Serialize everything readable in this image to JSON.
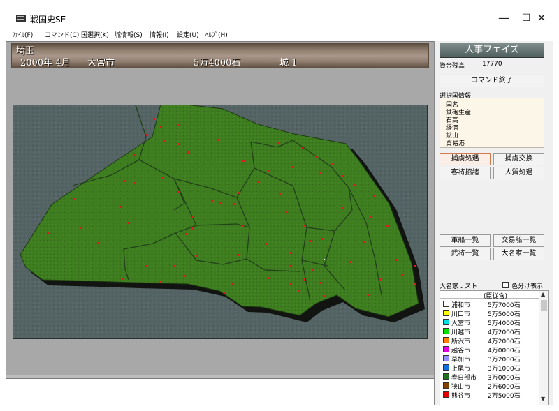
{
  "window": {
    "title": "戦国史SE",
    "minimize": "—",
    "maximize": "☐",
    "close": "✕"
  },
  "menu": [
    "ﾌｧｲﾙ(F)",
    "コマンド(C)",
    "国選択(K)",
    "城情報(S)",
    "情報(I)",
    "設定(U)",
    "ﾍﾙﾌﾟ(H)"
  ],
  "info": {
    "province": "埼玉",
    "date": "2000年 4月",
    "city": "大宮市",
    "yield": "5万4000石",
    "castles": "城 1"
  },
  "panel": {
    "phase": "人事フェイズ",
    "funds_label": "資金残高",
    "funds_value": "17770",
    "command_end": "コマンド終了",
    "selected_label": "選択国情報",
    "selected_lines": [
      "国名",
      "鉄砲生産",
      "石高",
      "経済",
      "鉱山",
      "貿易港"
    ],
    "buttons": {
      "capture_handle": "捕虜処遇",
      "capture_swap": "捕虜交換",
      "guest_recruit": "客将招諸",
      "hostage": "人質処遇",
      "warships": "軍船一覧",
      "tradeships": "交易船一覧",
      "generals": "武将一覧",
      "daimyos": "大名家一覧"
    },
    "daimyo_list_label": "大名家リスト",
    "color_toggle_label": "色分け表示",
    "list_header": "(臣従含)",
    "daimyos": [
      {
        "name": "浦和市",
        "value": "5万7000石",
        "color": "#ffffff"
      },
      {
        "name": "川口市",
        "value": "5万5000石",
        "color": "#ffff00"
      },
      {
        "name": "大宮市",
        "value": "5万4000石",
        "color": "#00e0e0"
      },
      {
        "name": "川越市",
        "value": "4万2000石",
        "color": "#00e000"
      },
      {
        "name": "所沢市",
        "value": "4万2000石",
        "color": "#ff8000"
      },
      {
        "name": "越谷市",
        "value": "4万0000石",
        "color": "#e000e0"
      },
      {
        "name": "草加市",
        "value": "3万2000石",
        "color": "#9090ff"
      },
      {
        "name": "上尾市",
        "value": "3万1000石",
        "color": "#1070e0"
      },
      {
        "name": "春日部市",
        "value": "3万0000石",
        "color": "#207020"
      },
      {
        "name": "狭山市",
        "value": "2万6000石",
        "color": "#804000"
      },
      {
        "name": "熊谷市",
        "value": "2万5000石",
        "color": "#e00000"
      }
    ]
  },
  "map": {
    "land_color": "#3f7f20",
    "border_color": "#1f3a12",
    "marker_color": "#d62020",
    "selected_marker_color": "#ffffff"
  }
}
